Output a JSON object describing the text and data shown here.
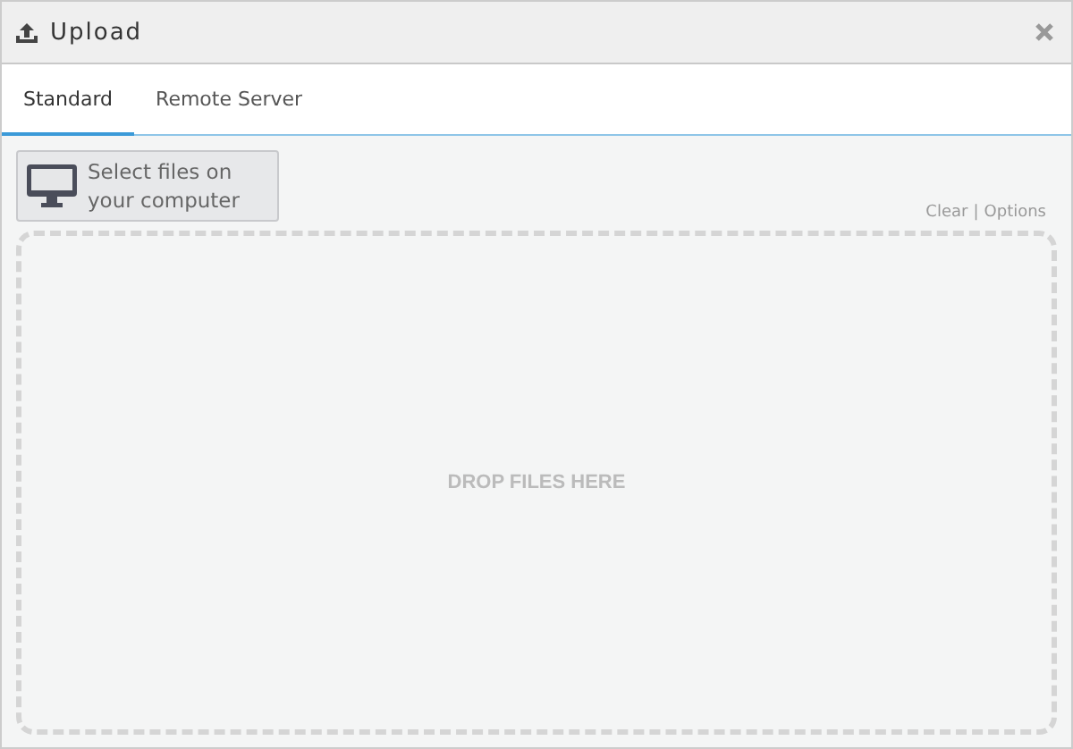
{
  "window": {
    "title": "Upload"
  },
  "tabs": [
    {
      "label": "Standard",
      "selected": true
    },
    {
      "label": "Remote Server",
      "selected": false
    }
  ],
  "select_button": {
    "label": "Select files on your computer"
  },
  "links": {
    "clear": "Clear",
    "separator": "|",
    "options": "Options"
  },
  "dropzone": {
    "text": "DROP FILES HERE"
  }
}
